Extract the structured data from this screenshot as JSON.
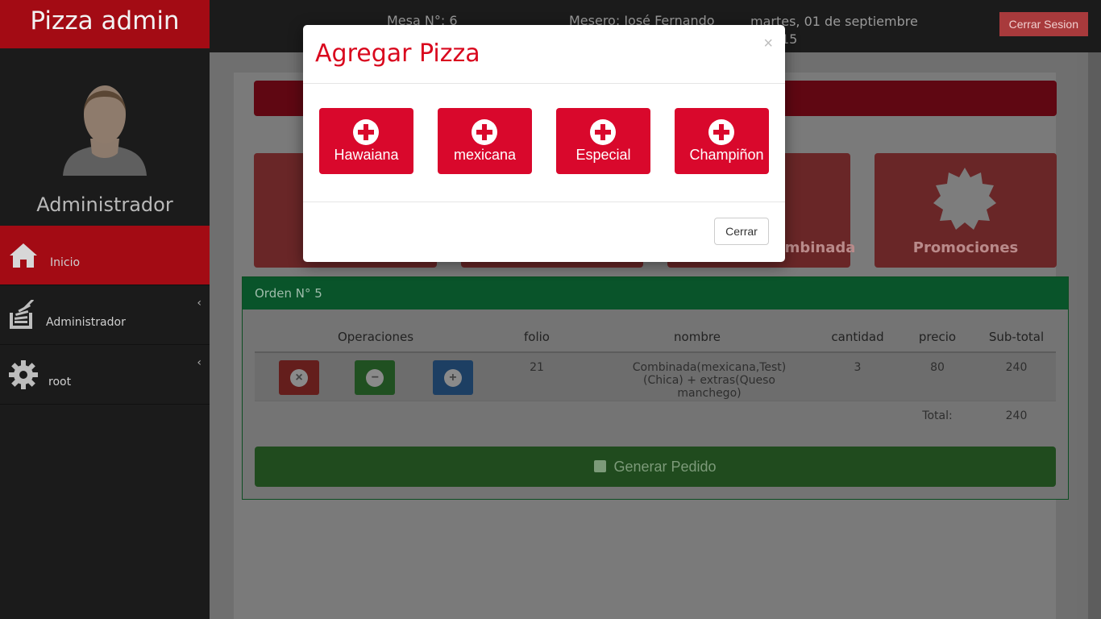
{
  "app": {
    "title": "Pizza admin"
  },
  "profile": {
    "name": "Administrador"
  },
  "sidebar": {
    "items": [
      {
        "label": "Inicio",
        "icon": "home-icon",
        "active": true
      },
      {
        "label": "Administrador",
        "icon": "stack-icon",
        "active": false
      },
      {
        "label": "root",
        "icon": "gear-icon",
        "active": false
      }
    ]
  },
  "topbar": {
    "mesa": "Mesa N°: 6",
    "mesero": "Mesero: José Fernando",
    "date_line1": "martes, 01 de septiembre",
    "date_line2": "15",
    "logout_label": "Cerrar Sesion"
  },
  "tiles": [
    {
      "label": "Combinada"
    },
    {
      "label": "Promociones"
    }
  ],
  "order": {
    "title": "Orden N° 5",
    "columns": [
      "Operaciones",
      "folio",
      "nombre",
      "cantidad",
      "precio",
      "Sub-total"
    ],
    "rows": [
      {
        "folio": "21",
        "nombre": "Combinada(mexicana,Test)(Chica) + extras(Queso manchego)",
        "cantidad": "3",
        "precio": "80",
        "subtotal": "240"
      }
    ],
    "total_label": "Total:",
    "total_value": "240",
    "generate_label": "Generar Pedido"
  },
  "modal": {
    "title": "Agregar Pizza",
    "close_symbol": "×",
    "pizzas": [
      "Hawaiana",
      "mexicana",
      "Especial",
      "Champiñon"
    ],
    "close_label": "Cerrar"
  },
  "colors": {
    "brand_red": "#d9082c",
    "sidebar_bg": "#1b1b1b",
    "order_green": "#0a9e4d"
  }
}
